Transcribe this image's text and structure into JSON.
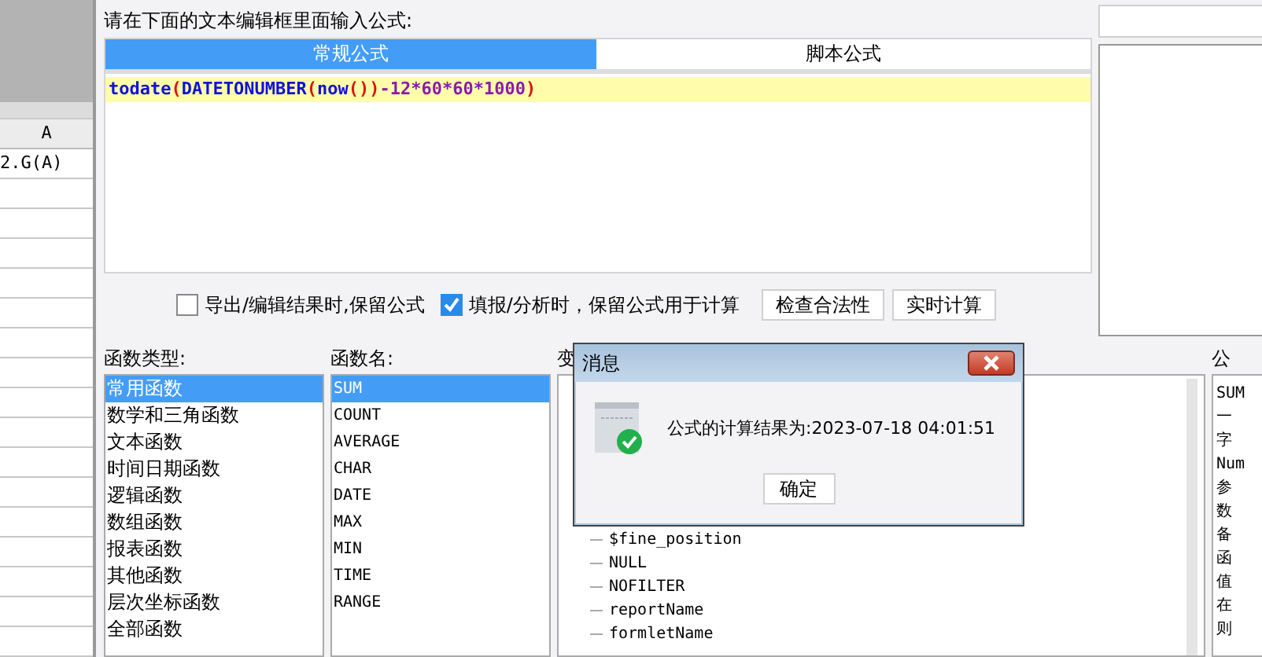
{
  "sheet": {
    "column_header": "A",
    "cells": [
      "2.G(A)",
      "",
      "",
      "",
      "",
      "",
      "",
      "",
      "",
      "",
      "",
      "",
      "",
      "",
      "",
      "",
      ""
    ]
  },
  "editor": {
    "prompt": "请在下面的文本编辑框里面输入公式:",
    "tabs": [
      {
        "label": "常规公式",
        "selected": true
      },
      {
        "label": "脚本公式",
        "selected": false
      }
    ],
    "formula": [
      {
        "kind": "func",
        "text": "todate"
      },
      {
        "kind": "paren",
        "text": "("
      },
      {
        "kind": "func",
        "text": "DATETONUMBER"
      },
      {
        "kind": "paren",
        "text": "("
      },
      {
        "kind": "func",
        "text": "now"
      },
      {
        "kind": "paren",
        "text": "())"
      },
      {
        "kind": "num",
        "text": "-12*60*60*1000"
      },
      {
        "kind": "paren",
        "text": ")"
      }
    ]
  },
  "options": [
    {
      "label": "导出/编辑结果时,保留公式",
      "checked": false
    },
    {
      "label": "填报/分析时，保留公式用于计算",
      "checked": true
    }
  ],
  "buttons": [
    "检查合法性",
    "实时计算"
  ],
  "function_types": {
    "label": "函数类型:",
    "items": [
      {
        "label": "常用函数",
        "selected": true
      },
      {
        "label": "数学和三角函数",
        "selected": false
      },
      {
        "label": "文本函数",
        "selected": false
      },
      {
        "label": "时间日期函数",
        "selected": false
      },
      {
        "label": "逻辑函数",
        "selected": false
      },
      {
        "label": "数组函数",
        "selected": false
      },
      {
        "label": "报表函数",
        "selected": false
      },
      {
        "label": "其他函数",
        "selected": false
      },
      {
        "label": "层次坐标函数",
        "selected": false
      },
      {
        "label": "全部函数",
        "selected": false
      }
    ]
  },
  "function_names": {
    "label": "函数名:",
    "items": [
      {
        "label": "SUM",
        "selected": true
      },
      {
        "label": "COUNT",
        "selected": false
      },
      {
        "label": "AVERAGE",
        "selected": false
      },
      {
        "label": "CHAR",
        "selected": false
      },
      {
        "label": "DATE",
        "selected": false
      },
      {
        "label": "MAX",
        "selected": false
      },
      {
        "label": "MIN",
        "selected": false
      },
      {
        "label": "TIME",
        "selected": false
      },
      {
        "label": "RANGE",
        "selected": false
      }
    ]
  },
  "variables": {
    "label": "变",
    "items": [
      "$fine_position",
      "NULL",
      "NOFILTER",
      "reportName",
      "formletName"
    ]
  },
  "description": {
    "label": "公",
    "lines": [
      "SUM",
      "一",
      "字",
      "Num",
      "参",
      "数",
      "备",
      "函",
      "值",
      "在",
      "则"
    ]
  },
  "dialog": {
    "title": "消息",
    "message": "公式的计算结果为:2023-07-18 04:01:51",
    "button": "确定"
  }
}
